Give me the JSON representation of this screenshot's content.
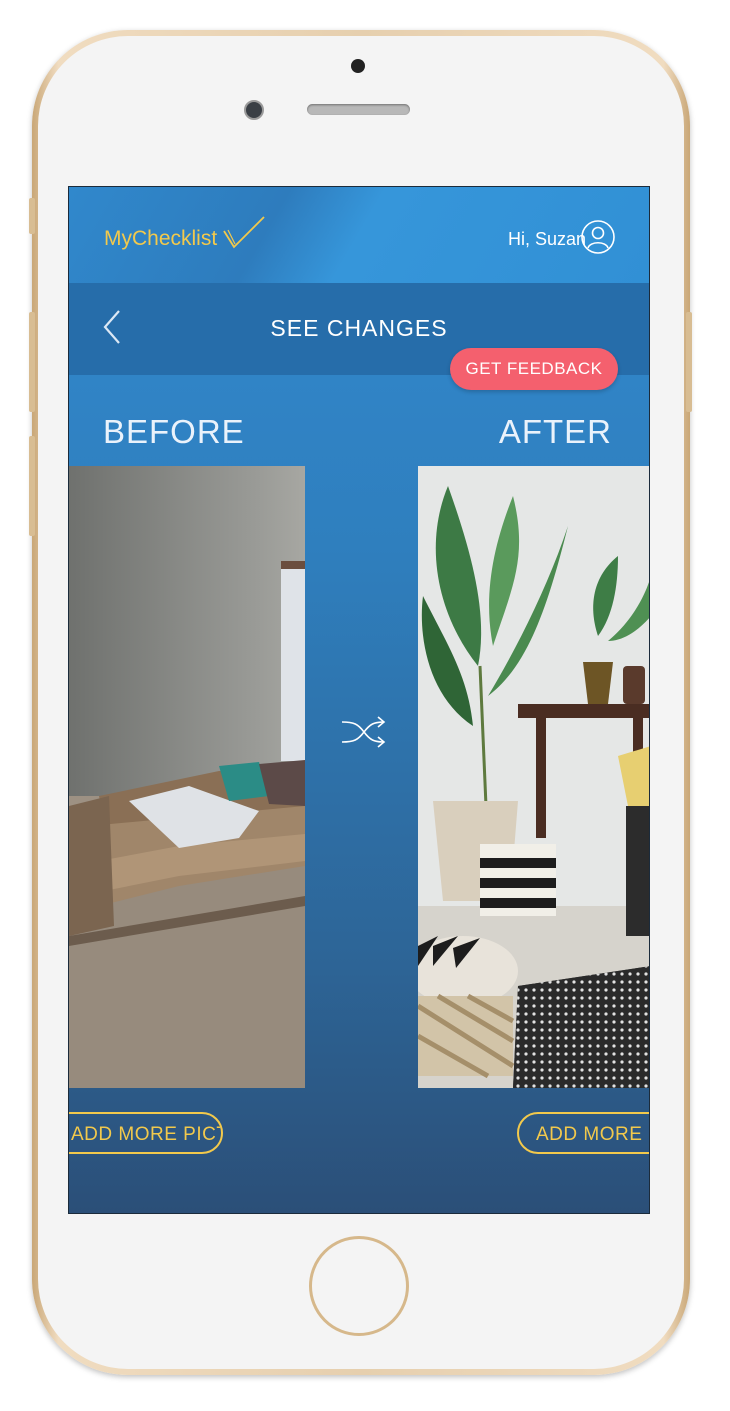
{
  "app": {
    "logo": "MyChecklist",
    "greeting": "Hi, Suzan"
  },
  "nav": {
    "title": "SEE CHANGES",
    "feedback_button": "GET FEEDBACK"
  },
  "compare": {
    "before_label": "BEFORE",
    "after_label": "AFTER",
    "before_add_button": "ADD MORE PICTURES",
    "after_add_button": "ADD MORE PICTURES"
  },
  "icons": {
    "back": "chevron-left-icon",
    "user": "user-circle-icon",
    "shuffle": "shuffle-icon"
  },
  "colors": {
    "accent_yellow": "#f2c94c",
    "feedback_pink": "#f4606e",
    "screen_blue": "#3189cf"
  }
}
